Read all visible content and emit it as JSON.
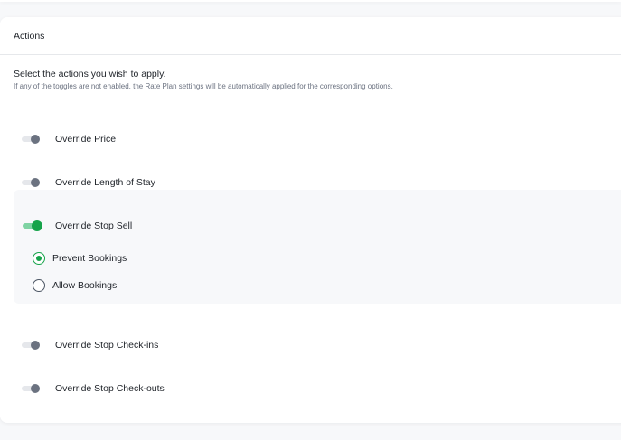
{
  "card": {
    "title": "Actions",
    "intro_title": "Select the actions you wish to apply.",
    "intro_note": "If any of the toggles are not enabled, the Rate Plan settings will be automatically applied for the corresponding options."
  },
  "actions": [
    {
      "label": "Override Price",
      "enabled": false
    },
    {
      "label": "Override Length of Stay",
      "enabled": false
    },
    {
      "label": "Override Stop Sell",
      "enabled": true
    },
    {
      "label": "Override Stop Check-ins",
      "enabled": false
    },
    {
      "label": "Override Stop Check-outs",
      "enabled": false
    }
  ],
  "stop_sell_options": [
    {
      "label": "Prevent Bookings",
      "selected": true
    },
    {
      "label": "Allow Bookings",
      "selected": false
    }
  ],
  "colors": {
    "accent": "#16a34a",
    "toggle_off_knob": "#6b7280",
    "panel_bg": "#f7f8fa"
  }
}
